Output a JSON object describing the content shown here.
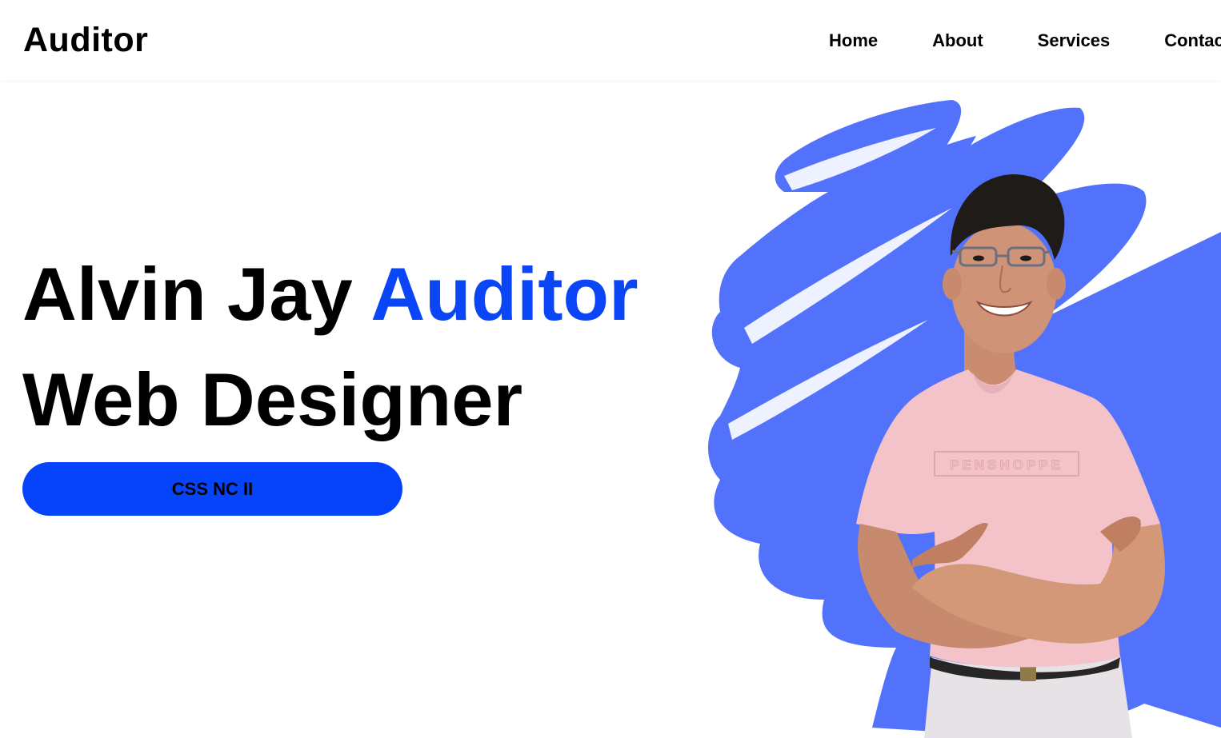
{
  "header": {
    "logo": "Auditor",
    "nav": [
      "Home",
      "About",
      "Services",
      "Contact"
    ]
  },
  "hero": {
    "first_name": "Alvin Jay",
    "last_name": "Auditor",
    "role": "Web Designer",
    "cta_label": "CSS NC II",
    "shirt_print": "PENSHOPPE"
  },
  "colors": {
    "accent": "#0a46f5",
    "button": "#0544fa",
    "scribble": "#5272fb",
    "shirt": "#f3c3c9"
  },
  "icons": {
    "portrait": "person-portrait-image",
    "backdrop": "blue-brush-scribble"
  }
}
